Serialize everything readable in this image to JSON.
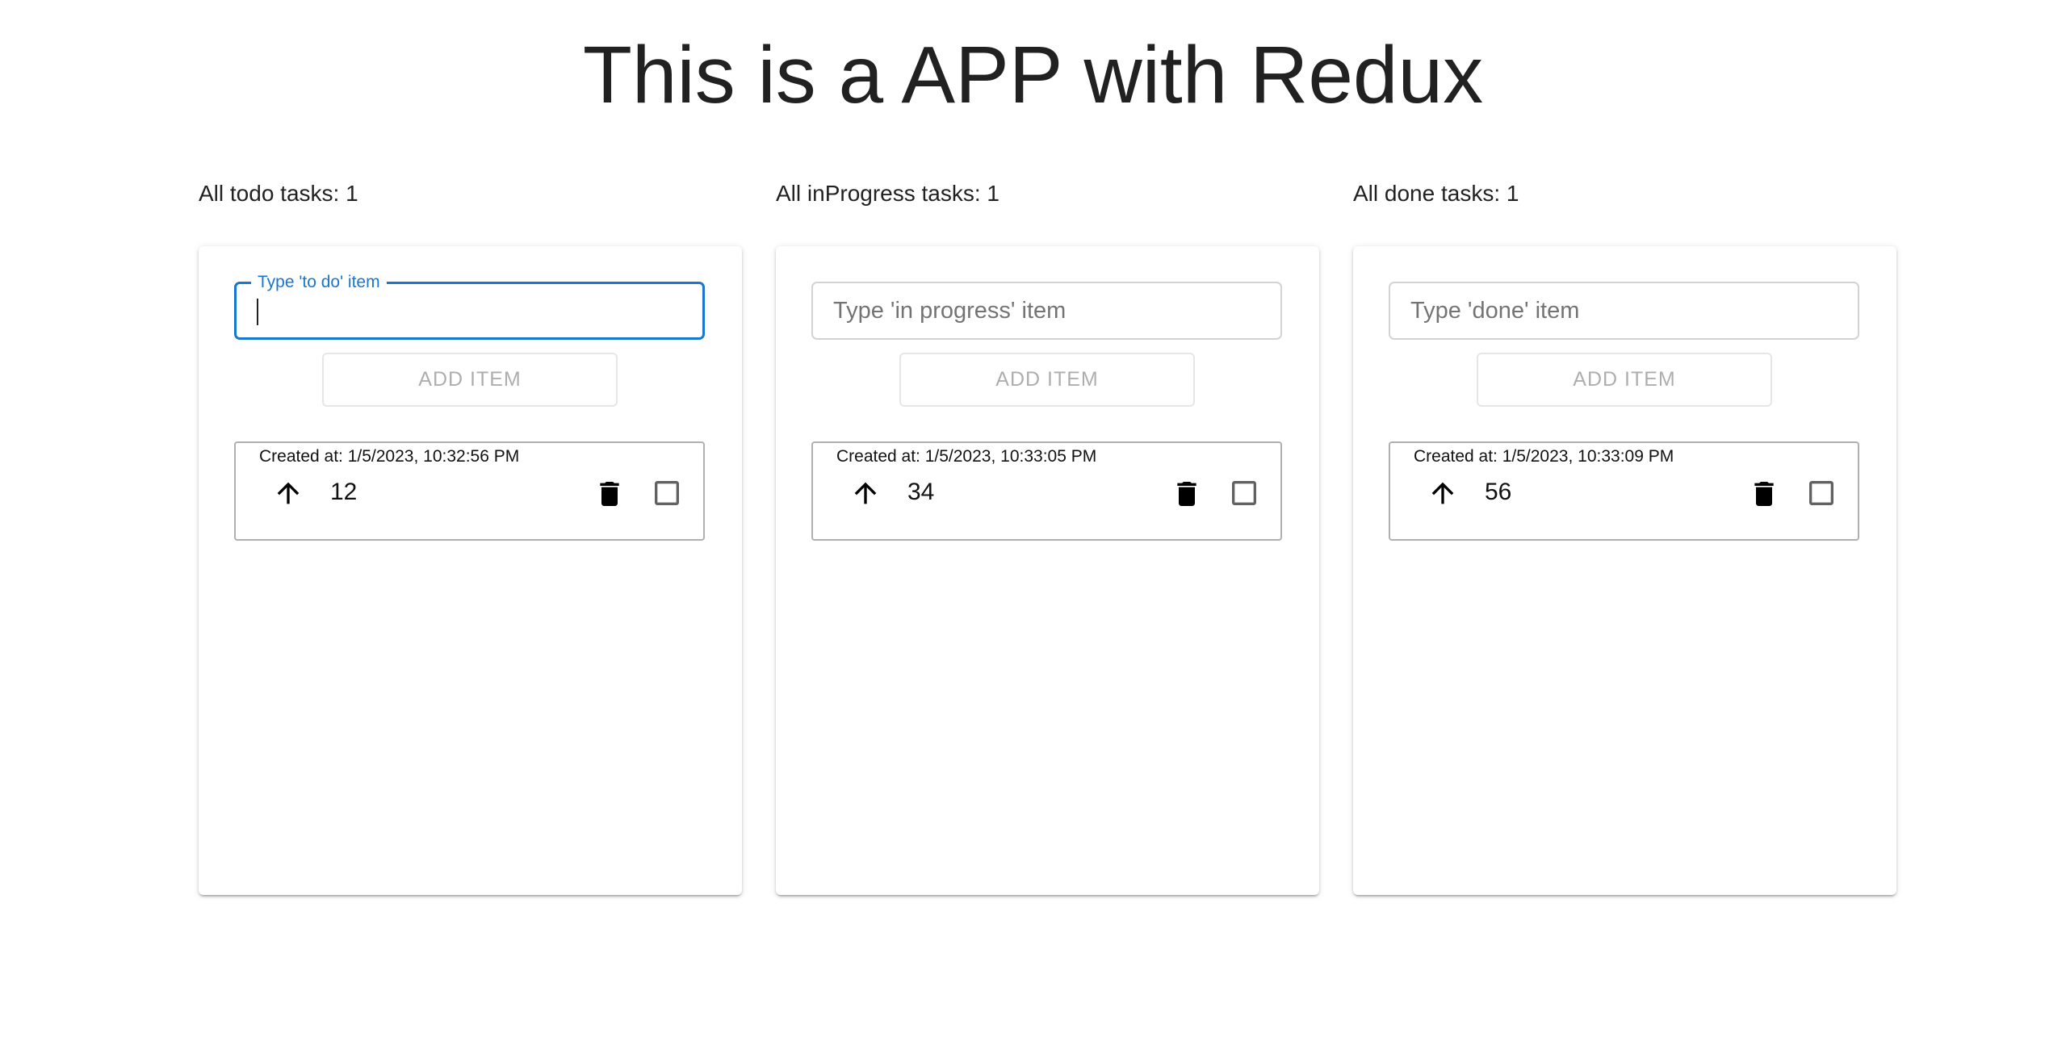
{
  "header": {
    "title": "This is a APP with Redux"
  },
  "columns": [
    {
      "count_label": "All todo tasks: 1",
      "input": {
        "label": "Type 'to do' item",
        "placeholder": "",
        "value": ""
      },
      "add_button": "ADD ITEM",
      "tasks": [
        {
          "created": "Created at: 1/5/2023, 10:32:56 PM",
          "value": "12",
          "checked": false
        }
      ]
    },
    {
      "count_label": "All inProgress tasks: 1",
      "input": {
        "placeholder": "Type 'in progress' item",
        "value": ""
      },
      "add_button": "ADD ITEM",
      "tasks": [
        {
          "created": "Created at: 1/5/2023, 10:33:05 PM",
          "value": "34",
          "checked": false
        }
      ]
    },
    {
      "count_label": "All done tasks: 1",
      "input": {
        "placeholder": "Type 'done' item",
        "value": ""
      },
      "add_button": "ADD ITEM",
      "tasks": [
        {
          "created": "Created at: 1/5/2023, 10:33:09 PM",
          "value": "56",
          "checked": false
        }
      ]
    }
  ],
  "icons": {
    "move": "arrow-up-icon",
    "delete": "trash-icon",
    "checkbox": "checkbox-unchecked-icon"
  },
  "colors": {
    "accent": "#1976d2",
    "text": "#212121",
    "disabled": "#b3b3b3"
  }
}
